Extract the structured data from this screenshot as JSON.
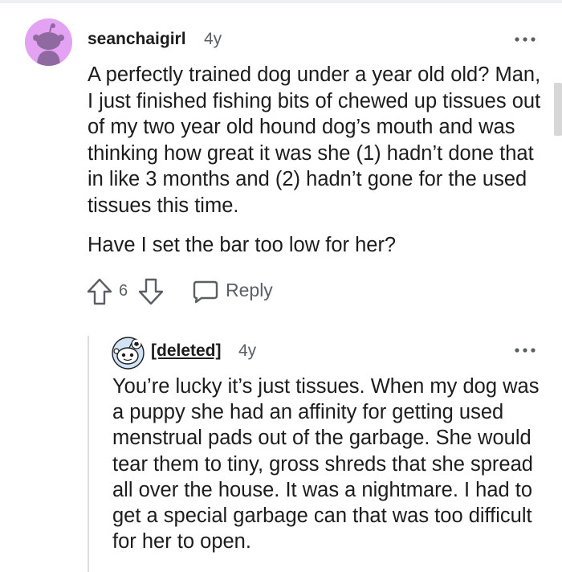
{
  "comment": {
    "username": "seanchaigirl",
    "age": "4y",
    "more_icon": "more-horizontal-icon",
    "avatar_color": "#e4a2f2",
    "paragraphs": [
      "A perfectly trained dog under a year old old? Man, I just finished fishing bits of chewed up tissues out of my two year old hound dog’s mouth and was thinking how great it was she (1) hadn’t done that in like 3 months and (2) hadn’t gone for the used tissues this time.",
      "Have I set the bar too low for her?"
    ],
    "score": "6",
    "reply_label": "Reply",
    "upvote_icon": "upvote-arrow-icon",
    "downvote_icon": "downvote-arrow-icon",
    "reply_icon": "speech-bubble-icon"
  },
  "reply": {
    "username": "[deleted]",
    "age": "4y",
    "more_icon": "more-horizontal-icon",
    "paragraphs": [
      "You’re lucky it’s just tissues. When my dog was a puppy she had an affinity for getting used menstrual pads out of the garbage. She would tear them to tiny, gross shreds that she spread all over the house. It was a nightmare. I had to get a special garbage can that was too difficult for her to open."
    ]
  },
  "colors": {
    "text_primary": "#1c1c1c",
    "text_secondary": "#5b5f63",
    "thread_line": "#dcdcdc"
  }
}
